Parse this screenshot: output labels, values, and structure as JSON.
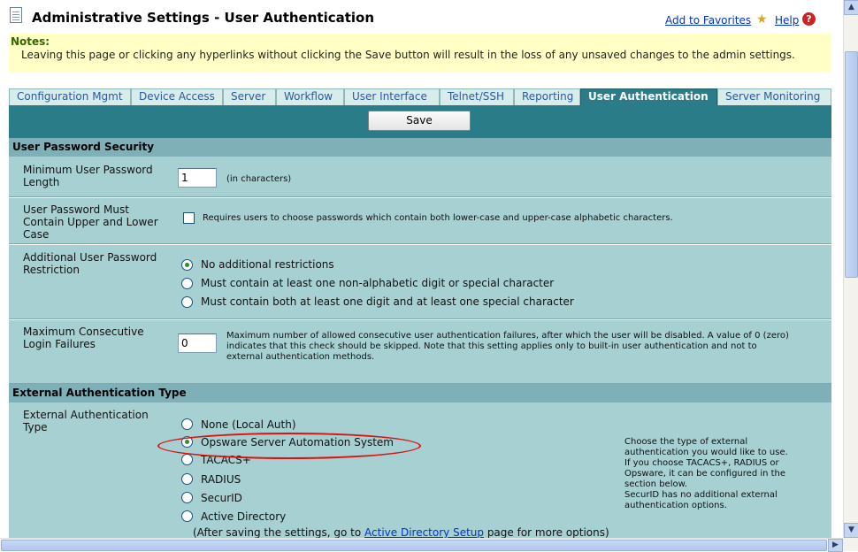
{
  "header": {
    "title": "Administrative Settings - User Authentication",
    "favorites_link": "Add to Favorites",
    "help_link": "Help",
    "help_icon_glyph": "?"
  },
  "notes": {
    "title": "Notes:",
    "text": "Leaving this page or clicking any hyperlinks without clicking the Save button will result in the loss of any unsaved changes to the admin settings."
  },
  "tabs": [
    {
      "label": "Configuration Mgmt",
      "active": false
    },
    {
      "label": "Device Access",
      "active": false
    },
    {
      "label": "Server",
      "active": false
    },
    {
      "label": "Workflow",
      "active": false
    },
    {
      "label": "User Interface",
      "active": false
    },
    {
      "label": "Telnet/SSH",
      "active": false
    },
    {
      "label": "Reporting",
      "active": false
    },
    {
      "label": "User Authentication",
      "active": true
    },
    {
      "label": "Server Monitoring",
      "active": false
    }
  ],
  "save_label": "Save",
  "password_section": {
    "title": "User Password Security",
    "min_length": {
      "label_l1": "Minimum User Password",
      "label_l2": "Length",
      "value": "1",
      "unit": "(in characters)"
    },
    "upper_lower": {
      "label_l1": "User Password Must",
      "label_l2": "Contain Upper and Lower",
      "label_l3": "Case",
      "checked": false,
      "description": "Requires users to choose passwords which contain both lower-case and upper-case alphabetic characters."
    },
    "additional": {
      "label_l1": "Additional User Password",
      "label_l2": "Restriction",
      "options": [
        {
          "label": "No additional restrictions",
          "selected": true
        },
        {
          "label": "Must contain at least one non-alphabetic digit or special character",
          "selected": false
        },
        {
          "label": "Must contain both at least one digit and at least one special character",
          "selected": false
        }
      ]
    },
    "max_failures": {
      "label_l1": "Maximum Consecutive",
      "label_l2": "Login Failures",
      "value": "0",
      "desc_l1": "Maximum number of allowed consecutive user authentication failures, after which the user will be disabled. A value of 0 (zero)",
      "desc_l2": "indicates that this check should be skipped. Note that this setting applies only to built-in user authentication and not to",
      "desc_l3": "external authentication methods."
    }
  },
  "external_section": {
    "title": "External Authentication Type",
    "label_l1": "External Authentication",
    "label_l2": "Type",
    "options": [
      {
        "label": "None (Local Auth)",
        "selected": false
      },
      {
        "label": "Opsware Server Automation System",
        "selected": true
      },
      {
        "label": "TACACS+",
        "selected": false
      },
      {
        "label": "RADIUS",
        "selected": false
      },
      {
        "label": "SecurID",
        "selected": false
      },
      {
        "label": "Active Directory",
        "selected": false
      }
    ],
    "note_prefix": "(After saving the settings, go to ",
    "note_link": "Active Directory Setup",
    "note_suffix": " page for more options)",
    "help_l1": "Choose the type of external",
    "help_l2": "authentication you would like to use.",
    "help_l3": "If you choose TACACS+, RADIUS or",
    "help_l4": "Opsware, it can be configured in the",
    "help_l5": "section below.",
    "help_l6": "SecurID has no additional external",
    "help_l7": "authentication options."
  },
  "icons": {
    "page": "document-icon",
    "favorites": "star-icon",
    "help": "help-icon"
  },
  "colors": {
    "tab_active": "#2b7c88",
    "band": "#2a7c88",
    "section_header": "#7fb0b8",
    "row_bg": "#a7d0d3",
    "notes_bg": "#ffffc6",
    "highlight_ellipse": "#dd1111"
  }
}
